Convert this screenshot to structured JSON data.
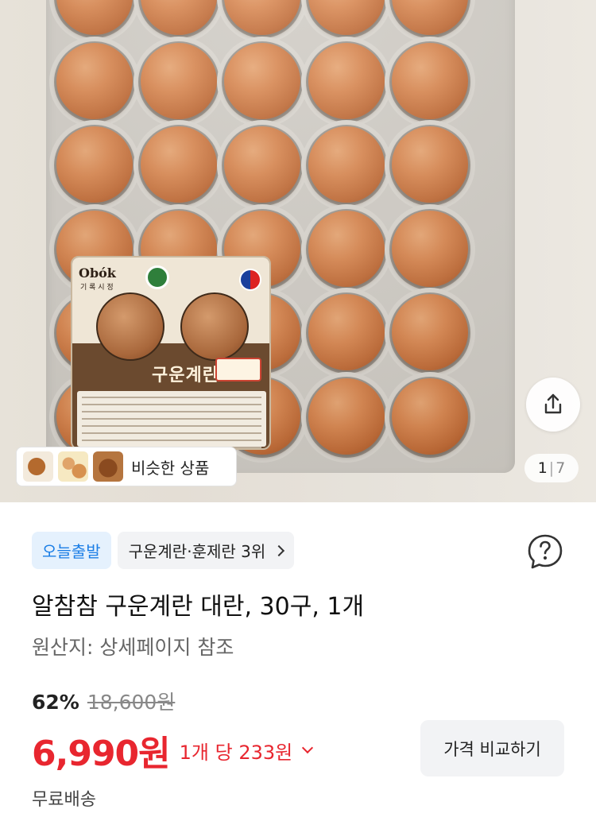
{
  "gallery": {
    "current": "1",
    "separator": "|",
    "total": "7",
    "share_icon": "share-icon",
    "pack_brand": "Obók",
    "pack_brand_sub": "기 록 시 정",
    "pack_title": "구운계란"
  },
  "similar": {
    "label": "비슷한 상품",
    "thumbnails": [
      "braised-egg",
      "eggs-in-basket",
      "roasted-eggs"
    ]
  },
  "badges": {
    "delivery": "오늘출발",
    "ranking": "구운계란·훈제란 3위"
  },
  "help_icon": "question-icon",
  "product": {
    "title": "알참참 구운계란 대란, 30구, 1개",
    "origin": "원산지: 상세페이지 참조"
  },
  "pricing": {
    "discount": "62%",
    "original_price": "18,600원",
    "sale_price": "6,990원",
    "unit_price": "1개 당 233원",
    "compare_label": "가격 비교하기"
  },
  "shipping": {
    "label": "무료배송"
  },
  "colors": {
    "price_red": "#e8262f",
    "badge_blue": "#1b7ee6",
    "badge_blue_bg": "#e5f1fd"
  }
}
